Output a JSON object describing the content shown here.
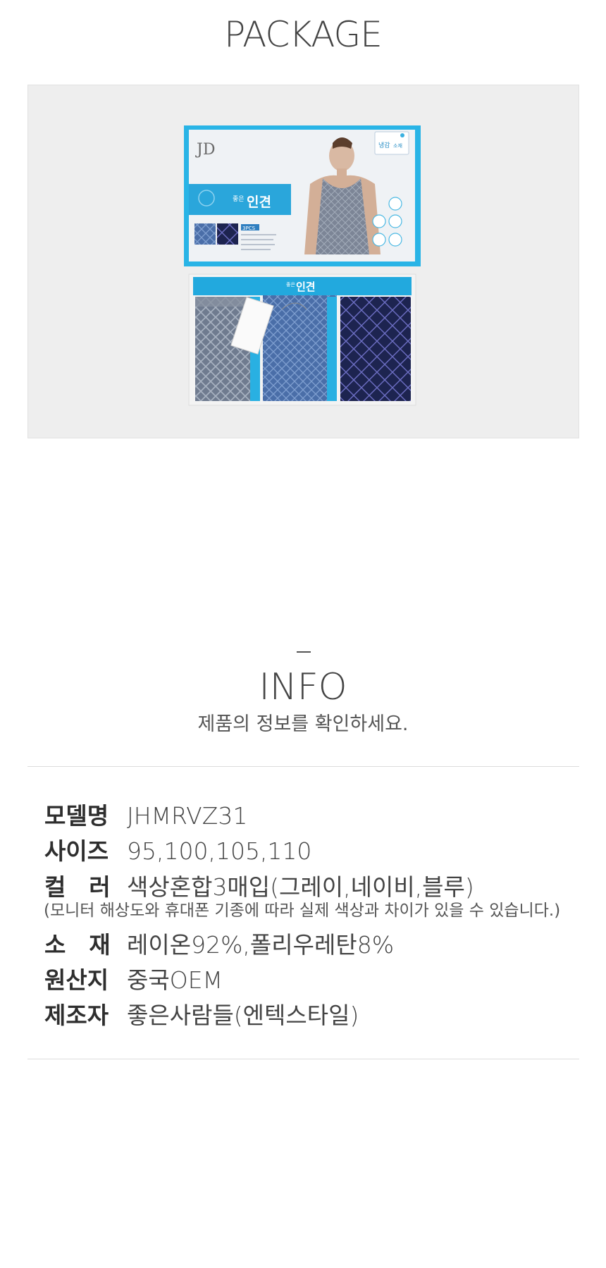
{
  "package": {
    "title": "PACKAGE"
  },
  "product_box": {
    "brand_logo": "JD",
    "product_name_small": "좋은",
    "product_name": "인견",
    "badge": "냉감",
    "badge_sub": "소재",
    "count_label": "3PCS",
    "tray_small": "좋은",
    "tray_name": "인견"
  },
  "info": {
    "title": "INFO",
    "subtitle": "제품의 정보를 확인하세요.",
    "rows": [
      {
        "label": "모델명",
        "value": "JHMRVZ31"
      },
      {
        "label": "사이즈",
        "value": "95,100,105,110"
      },
      {
        "label": "컬　러",
        "value": "색상혼합3매입(그레이,네이비,블루)"
      },
      {
        "label": "소　재",
        "value": "레이온92%,폴리우레탄8%"
      },
      {
        "label": "원산지",
        "value": "중국OEM"
      },
      {
        "label": "제조자",
        "value": "좋은사람들(엔텍스타일)"
      }
    ],
    "color_note": "(모니터 해상도와 휴대폰 기종에 따라 실제 색상과 차이가 있을 수 있습니다.)"
  },
  "colors": {
    "box_blue": "#29b4e6",
    "tray_blue": "#22a9de",
    "gray_shirt": "#6f7b8f",
    "blue_shirt": "#4a6ea8",
    "navy_shirt": "#1d2450"
  }
}
